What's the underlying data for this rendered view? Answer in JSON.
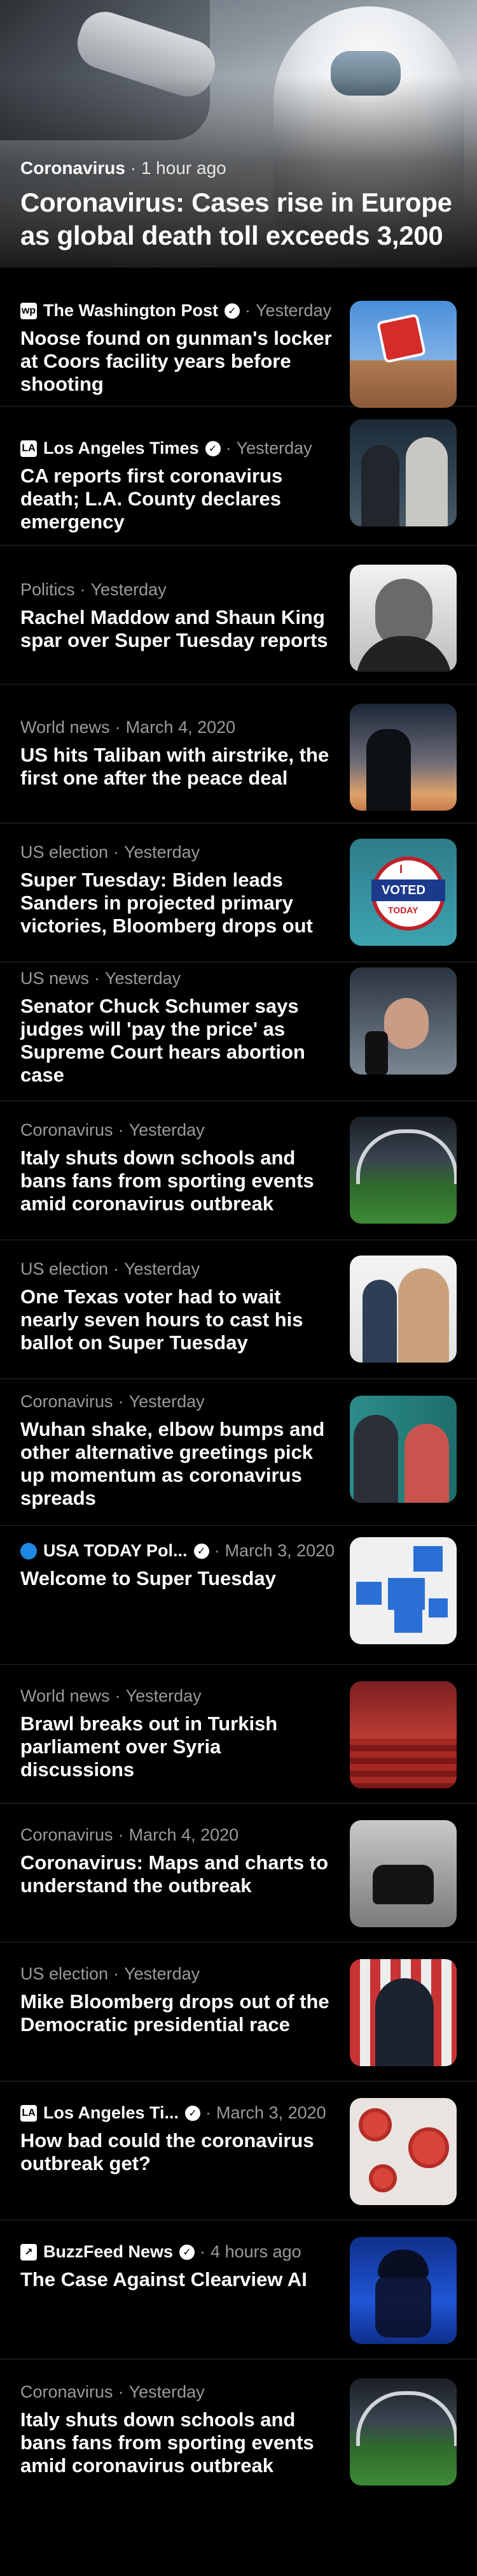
{
  "hero": {
    "category": "Coronavirus",
    "separator": "·",
    "time": "1 hour ago",
    "title": "Coronavirus: Cases rise in Europe as global death toll exceeds 3,200"
  },
  "separator": "·",
  "stories": [
    {
      "source": "The Washington Post",
      "verified": true,
      "logo": "wp",
      "time": "Yesterday",
      "title": "Noose found on gunman's locker at Coors facility years before shooting"
    },
    {
      "source": "Los Angeles Times",
      "verified": true,
      "logo": "LA",
      "time": "Yesterday",
      "title": "CA reports first coronavirus death; L.A. County declares emergency"
    },
    {
      "category": "Politics",
      "time": "Yesterday",
      "title": "Rachel Maddow and Shaun King spar over Super Tuesday reports"
    },
    {
      "category": "World news",
      "time": "March 4, 2020",
      "title": "US hits Taliban with airstrike, the first one after the peace deal"
    },
    {
      "category": "US election",
      "time": "Yesterday",
      "title": "Super Tuesday: Biden leads Sanders in projected primary victories, Bloomberg drops out"
    },
    {
      "category": "US news",
      "time": "Yesterday",
      "title": "Senator Chuck Schumer says judges will 'pay the price' as Supreme Court hears abortion case"
    },
    {
      "category": "Coronavirus",
      "time": "Yesterday",
      "title": "Italy shuts down schools and bans fans from sporting events amid coronavirus outbreak"
    },
    {
      "category": "US election",
      "time": "Yesterday",
      "title": "One Texas voter had to wait nearly seven hours to cast his ballot on Super Tuesday"
    },
    {
      "category": "Coronavirus",
      "time": "Yesterday",
      "title": "Wuhan shake, elbow bumps and other alternative greetings pick up momentum as coronavirus spreads"
    },
    {
      "source": "USA TODAY Pol...",
      "verified": true,
      "logo": "circle",
      "time": "March 3, 2020",
      "title": "Welcome to Super Tuesday"
    },
    {
      "category": "World news",
      "time": "Yesterday",
      "title": "Brawl breaks out in Turkish parliament over Syria discussions"
    },
    {
      "category": "Coronavirus",
      "time": "March 4, 2020",
      "title": "Coronavirus: Maps and charts to understand the outbreak"
    },
    {
      "category": "US election",
      "time": "Yesterday",
      "title": "Mike Bloomberg drops out of the Democratic presidential race"
    },
    {
      "source": "Los Angeles Ti...",
      "verified": true,
      "logo": "LA",
      "time": "March 3, 2020",
      "title": "How bad could the coronavirus outbreak get?"
    },
    {
      "source": "BuzzFeed News",
      "verified": true,
      "logo": "BF",
      "time": "4 hours ago",
      "title": "The Case Against Clearview AI"
    },
    {
      "category": "Coronavirus",
      "time": "Yesterday",
      "title": "Italy shuts down schools and bans fans from sporting events amid coronavirus outbreak"
    }
  ],
  "thumbnails": {
    "voted_text": "VOTED",
    "i_text": "I",
    "today_text": "TODAY"
  }
}
